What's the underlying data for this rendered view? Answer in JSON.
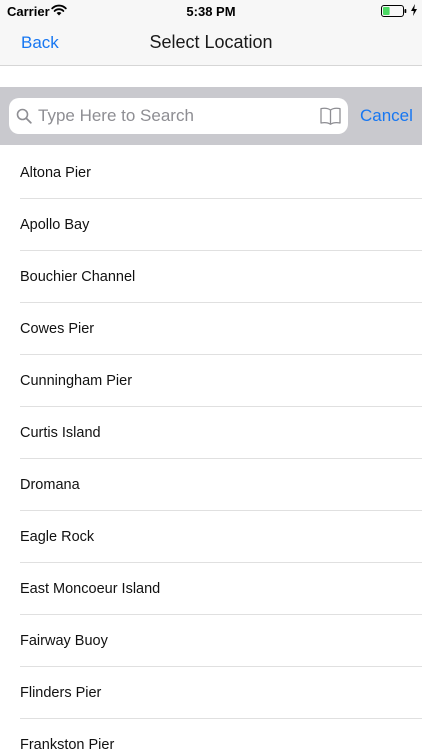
{
  "status_bar": {
    "carrier": "Carrier",
    "time": "5:38 PM",
    "battery_level": 0.35,
    "battery_color": "#4cd964",
    "icons": [
      "wifi-icon",
      "battery-icon",
      "charging-bolt-icon"
    ]
  },
  "nav": {
    "back_label": "Back",
    "title": "Select Location"
  },
  "search": {
    "placeholder": "Type Here to Search",
    "value": "",
    "cancel_label": "Cancel",
    "icons": [
      "search-icon",
      "bookmark-book-icon"
    ]
  },
  "locations": [
    "Altona Pier",
    "Apollo Bay",
    "Bouchier Channel",
    "Cowes Pier",
    "Cunningham Pier",
    "Curtis Island",
    "Dromana",
    "Eagle Rock",
    "East Moncoeur Island",
    "Fairway Buoy",
    "Flinders Pier",
    "Frankston Pier"
  ],
  "colors": {
    "accent": "#1777f2",
    "search_bar_background": "#c9c9ce",
    "nav_background": "#f7f7f7"
  }
}
